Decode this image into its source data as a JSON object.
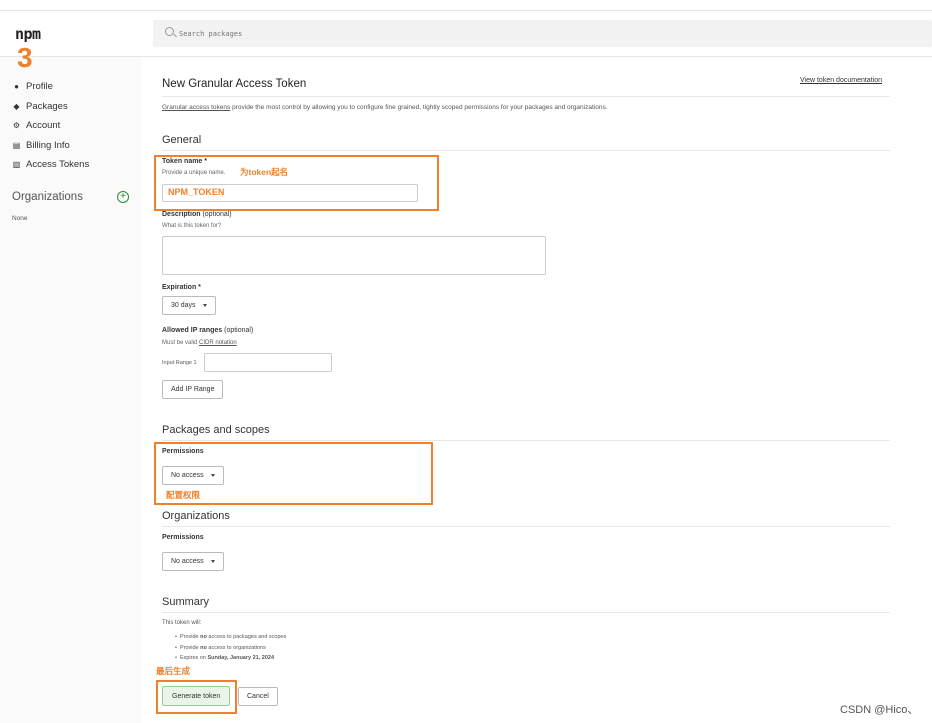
{
  "header": {
    "logo": "npm",
    "search_placeholder": "Search packages"
  },
  "annotations": {
    "step_number": "3",
    "token_name_note": "为token起名",
    "permissions_note": "配置权限",
    "generate_note": "最后生成",
    "color": "#f0802b"
  },
  "sidebar": {
    "items": [
      {
        "label": "Profile",
        "icon": "user-icon"
      },
      {
        "label": "Packages",
        "icon": "packages-icon"
      },
      {
        "label": "Account",
        "icon": "gear-icon"
      },
      {
        "label": "Billing Info",
        "icon": "billing-icon"
      },
      {
        "label": "Access Tokens",
        "icon": "token-icon"
      }
    ],
    "organizations_heading": "Organizations",
    "organizations_value": "None"
  },
  "page": {
    "title": "New Granular Access Token",
    "doc_link": "View token documentation",
    "intro_link": "Granular access tokens",
    "intro_rest": " provide the most control by allowing you to configure fine grained, tightly scoped permissions for your packages and organizations."
  },
  "general": {
    "heading": "General",
    "token_name_label": "Token name *",
    "token_name_hint": "Provide a unique name.",
    "token_name_value": "NPM_TOKEN",
    "description_label": "Description",
    "description_optional": " (optional)",
    "description_hint": "What is this token for?",
    "expiration_label": "Expiration *",
    "expiration_value": "30 days",
    "ip_label": "Allowed IP ranges",
    "ip_optional": " (optional)",
    "ip_hint_prefix": "Must be valid ",
    "ip_hint_link": "CIDR notation",
    "ip_range_label": "Input Range 1",
    "add_ip_button": "Add IP Range"
  },
  "packages_scopes": {
    "heading": "Packages and scopes",
    "permissions_label": "Permissions",
    "permissions_value": "No access"
  },
  "organizations": {
    "heading": "Organizations",
    "permissions_label": "Permissions",
    "permissions_value": "No access"
  },
  "summary": {
    "heading": "Summary",
    "intro": "This token will:",
    "items": [
      {
        "pre": "Provide ",
        "bold": "no",
        "post": " access to packages and scopes"
      },
      {
        "pre": "Provide ",
        "bold": "no",
        "post": " access to organizations"
      },
      {
        "pre": "Expires on ",
        "bold": "Sunday, January 21, 2024",
        "post": ""
      }
    ],
    "generate_button": "Generate token",
    "cancel_button": "Cancel"
  },
  "watermark": "CSDN @Hico、"
}
